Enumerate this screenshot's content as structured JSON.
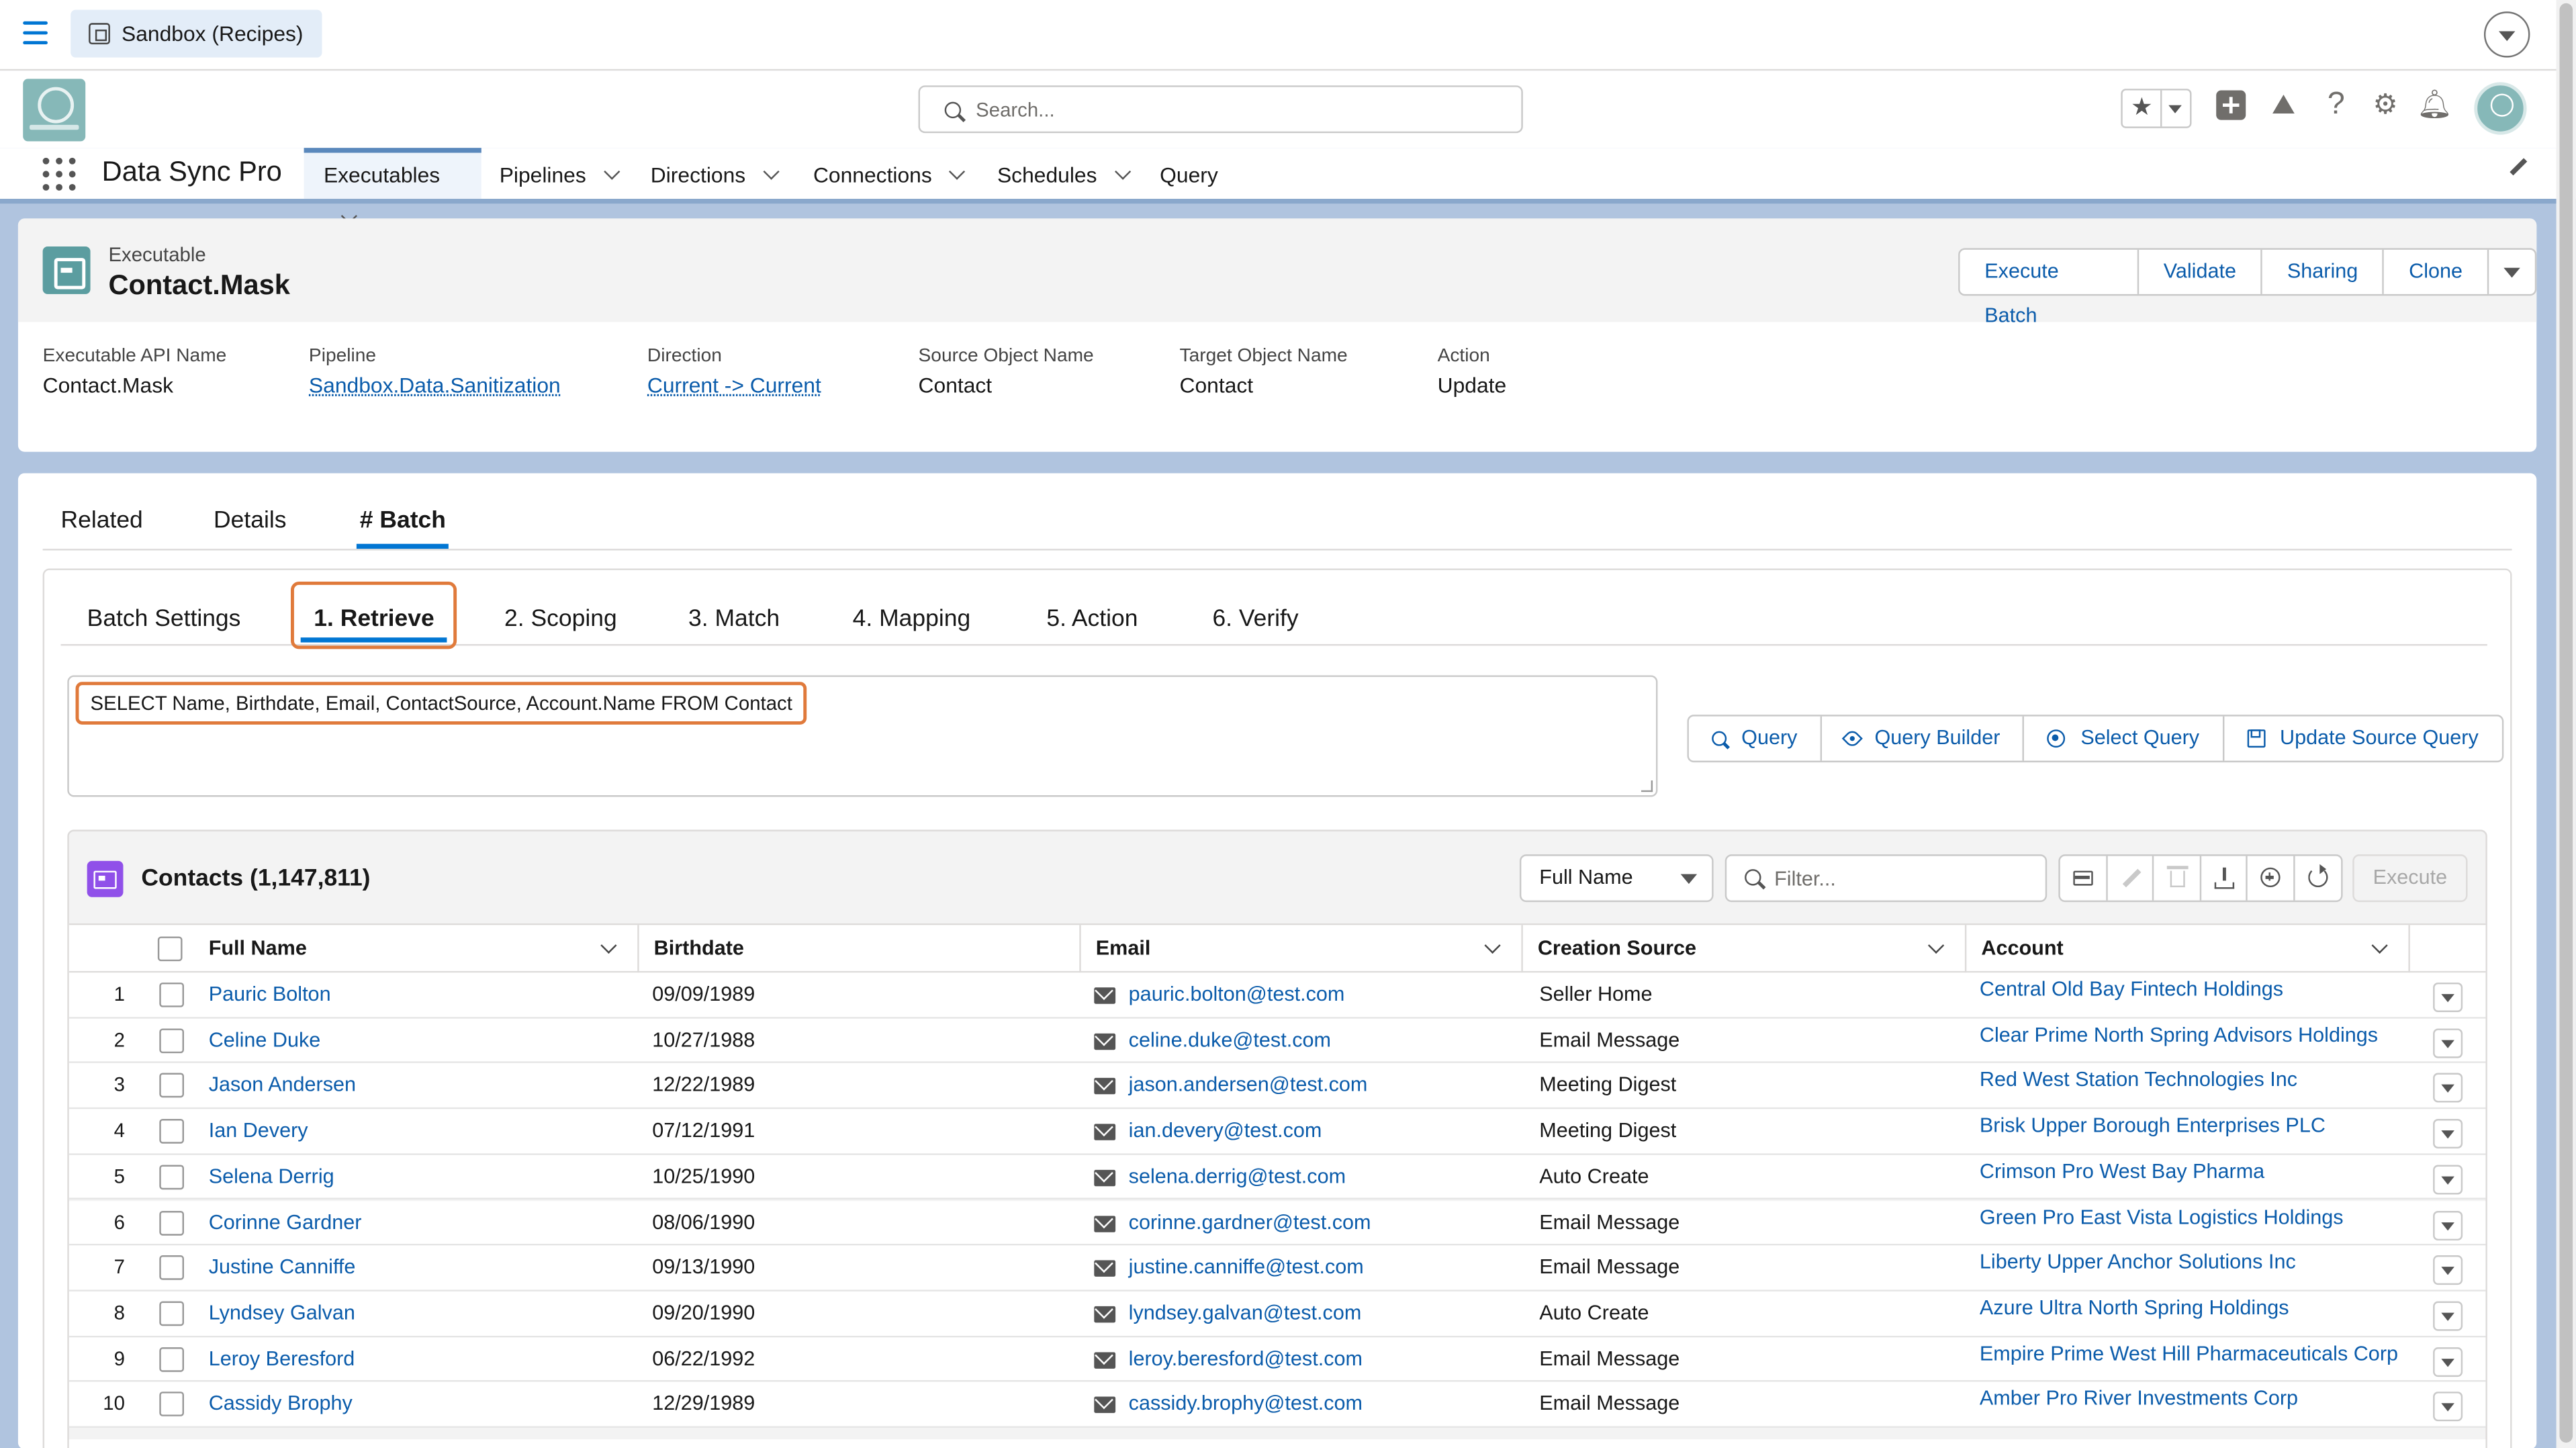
{
  "topbar": {
    "org_label": "Sandbox (Recipes)"
  },
  "header": {
    "search_placeholder": "Search...",
    "app_name": "Data Sync Pro",
    "nav_tabs": [
      {
        "label": "Executables",
        "active": true
      },
      {
        "label": "Pipelines"
      },
      {
        "label": "Directions"
      },
      {
        "label": "Connections"
      },
      {
        "label": "Schedules"
      },
      {
        "label": "Query"
      }
    ]
  },
  "record": {
    "type_label": "Executable",
    "name": "Contact.Mask",
    "actions": [
      "Execute Batch",
      "Validate",
      "Sharing",
      "Clone"
    ],
    "fields": [
      {
        "label": "Executable API Name",
        "value": "Contact.Mask"
      },
      {
        "label": "Pipeline",
        "value": "Sandbox.Data.Sanitization"
      },
      {
        "label": "Direction",
        "value": "Current -> Current"
      },
      {
        "label": "Source Object Name",
        "value": "Contact"
      },
      {
        "label": "Target Object Name",
        "value": "Contact"
      },
      {
        "label": "Action",
        "value": "Update"
      }
    ]
  },
  "record_tabs": [
    "Related",
    "Details",
    "# Batch"
  ],
  "sub_tabs": [
    "Batch Settings",
    "1. Retrieve",
    "2. Scoping",
    "3. Match",
    "4. Mapping",
    "5. Action",
    "6. Verify"
  ],
  "query": {
    "text": "SELECT Name, Birthdate, Email, ContactSource, Account.Name FROM Contact",
    "buttons": [
      "Query",
      "Query Builder",
      "Select Query",
      "Update Source Query"
    ]
  },
  "table": {
    "title": "Contacts (1,147,811)",
    "sort_field": "Full Name",
    "filter_placeholder": "Filter...",
    "execute_label": "Execute",
    "columns": [
      "Full Name",
      "Birthdate",
      "Email",
      "Creation Source",
      "Account"
    ],
    "rows": [
      {
        "n": "1",
        "name": "Pauric Bolton",
        "birth": "09/09/1989",
        "email": "pauric.bolton@test.com",
        "source": "Seller Home",
        "account": "Central Old Bay Fintech Holdings"
      },
      {
        "n": "2",
        "name": "Celine Duke",
        "birth": "10/27/1988",
        "email": "celine.duke@test.com",
        "source": "Email Message",
        "account": "Clear Prime North Spring Advisors Holdings"
      },
      {
        "n": "3",
        "name": "Jason Andersen",
        "birth": "12/22/1989",
        "email": "jason.andersen@test.com",
        "source": "Meeting Digest",
        "account": "Red West Station Technologies Inc"
      },
      {
        "n": "4",
        "name": "Ian Devery",
        "birth": "07/12/1991",
        "email": "ian.devery@test.com",
        "source": "Meeting Digest",
        "account": "Brisk Upper Borough Enterprises PLC"
      },
      {
        "n": "5",
        "name": "Selena Derrig",
        "birth": "10/25/1990",
        "email": "selena.derrig@test.com",
        "source": "Auto Create",
        "account": "Crimson Pro West Bay Pharma"
      },
      {
        "n": "6",
        "name": "Corinne Gardner",
        "birth": "08/06/1990",
        "email": "corinne.gardner@test.com",
        "source": "Email Message",
        "account": "Green Pro East Vista Logistics Holdings"
      },
      {
        "n": "7",
        "name": "Justine Canniffe",
        "birth": "09/13/1990",
        "email": "justine.canniffe@test.com",
        "source": "Email Message",
        "account": "Liberty Upper Anchor Solutions Inc"
      },
      {
        "n": "8",
        "name": "Lyndsey Galvan",
        "birth": "09/20/1990",
        "email": "lyndsey.galvan@test.com",
        "source": "Auto Create",
        "account": "Azure Ultra North Spring Holdings"
      },
      {
        "n": "9",
        "name": "Leroy Beresford",
        "birth": "06/22/1992",
        "email": "leroy.beresford@test.com",
        "source": "Email Message",
        "account": "Empire Prime West Hill Pharmaceuticals Corp"
      },
      {
        "n": "10",
        "name": "Cassidy Brophy",
        "birth": "12/29/1989",
        "email": "cassidy.brophy@test.com",
        "source": "Email Message",
        "account": "Amber Pro River Investments Corp"
      }
    ]
  },
  "colors": {
    "brand": "#0176d3",
    "link": "#0b5cab",
    "highlight": "#e07a3b",
    "page_bg": "#b0c4df"
  }
}
